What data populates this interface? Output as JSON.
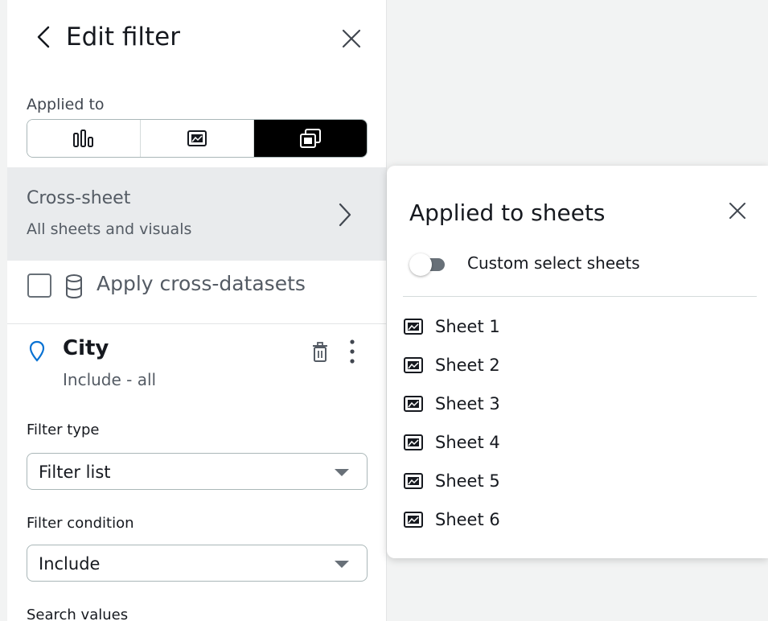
{
  "panel": {
    "title": "Edit filter",
    "applied_to_label": "Applied to",
    "segments": [
      {
        "icon": "bar-chart-icon",
        "active": false
      },
      {
        "icon": "sheet-icon",
        "active": false
      },
      {
        "icon": "multi-sheet-icon",
        "active": true
      }
    ],
    "cross_sheet": {
      "title": "Cross-sheet",
      "subtitle": "All sheets and visuals"
    },
    "apply_cross_datasets": {
      "label": "Apply cross-datasets",
      "checked": false
    },
    "field": {
      "name": "City",
      "summary": "Include - all"
    },
    "filter_type": {
      "label": "Filter type",
      "value": "Filter list"
    },
    "filter_condition": {
      "label": "Filter condition",
      "value": "Include"
    },
    "search_values_label": "Search values"
  },
  "popover": {
    "title": "Applied to sheets",
    "toggle": {
      "label": "Custom select sheets",
      "on": false
    },
    "sheets": [
      "Sheet 1",
      "Sheet 2",
      "Sheet 3",
      "Sheet 4",
      "Sheet 5",
      "Sheet 6"
    ]
  },
  "colors": {
    "accent_pin": "#0972d3",
    "active_segment": "#000000",
    "highlight_row": "#e9ebed"
  }
}
